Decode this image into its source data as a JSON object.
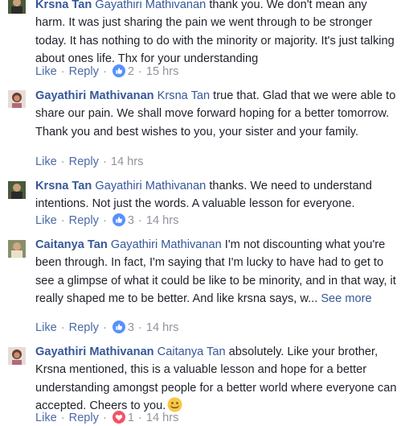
{
  "comments": [
    {
      "author": "Krsna Tan",
      "mention": "Gayathiri Mathivanan",
      "text": " thank you. We don't mean any harm. It was just sharing the pain we went through to be stronger today. It has nothing to do with the minority or majority. It's just talking about ones life. Thx for your understanding",
      "like_label": "Like",
      "reply_label": "Reply",
      "reaction_icon": "like-icon",
      "reaction_count": "2",
      "time": "15 hrs"
    },
    {
      "author": "Gayathiri Mathivanan",
      "mention": "Krsna Tan",
      "text": " true that. Glad that we were able to share our pain. We shall move forward hoping for a better tomorrow. Thank you and best wishes to you, your sister and your family.",
      "like_label": "Like",
      "reply_label": "Reply",
      "time": "14 hrs"
    },
    {
      "author": "Krsna Tan",
      "mention": "Gayathiri Mathivanan",
      "text": " thanks. We need to understand intentions. Not just the words. A valuable lesson for everyone.",
      "like_label": "Like",
      "reply_label": "Reply",
      "reaction_icon": "like-icon",
      "reaction_count": "3",
      "time": "14 hrs"
    },
    {
      "author": "Caitanya Tan",
      "mention": "Gayathiri Mathivanan",
      "text": " I'm not discounting what you're been through. In fact, I'm saying that I'm lucky to have had to get to see a glimpse of what it could be like to be minority, and in that way, it really shaped me to be better. And like krsna says, w...",
      "see_more": "See more",
      "like_label": "Like",
      "reply_label": "Reply",
      "reaction_icon": "like-icon",
      "reaction_count": "3",
      "time": "14 hrs"
    },
    {
      "author": "Gayathiri Mathivanan",
      "mention": "Caitanya Tan",
      "text": " absolutely. Like your brother, Krsna mentioned, this is a valuable lesson and hope for a better understanding amongst people for a better world where everyone can accepted. Cheers to you.",
      "emoji": "smiley-emoji",
      "like_label": "Like",
      "reply_label": "Reply",
      "reaction_icon": "love-icon",
      "reaction_count": "1",
      "time": "14 hrs"
    }
  ],
  "colors": {
    "link": "#365899",
    "meta": "#90949c",
    "like_blue": "#5890ff",
    "love_red": "#f25268"
  }
}
